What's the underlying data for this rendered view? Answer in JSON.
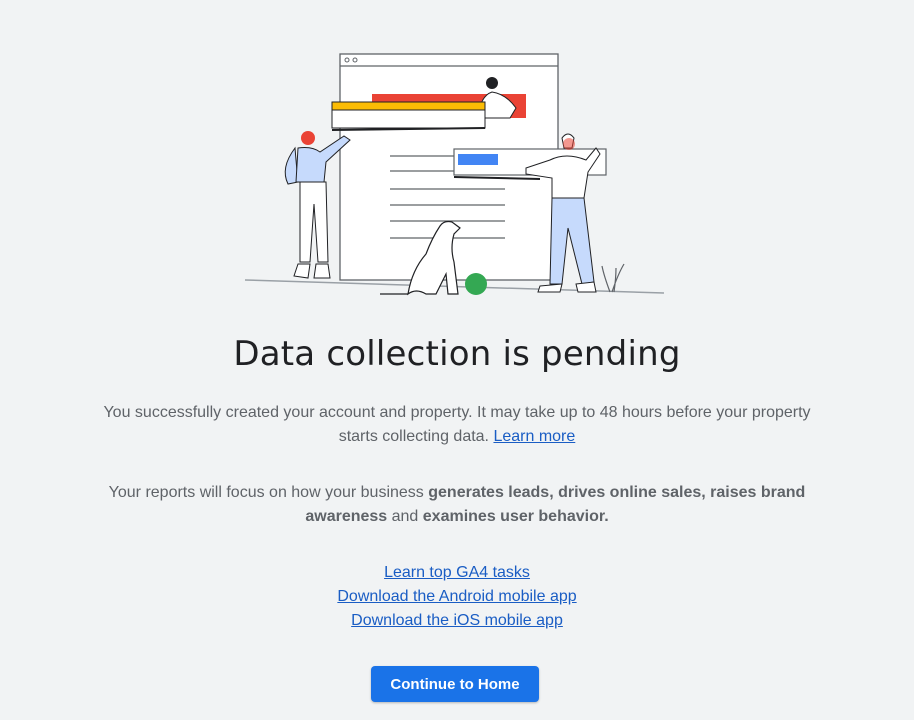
{
  "main": {
    "title": "Data collection is pending",
    "para1_text": "You successfully created your account and property. It may take up to 48 hours before your property starts collecting data. ",
    "para1_link": "Learn more",
    "para2_pre": "Your reports will focus on how your business ",
    "para2_bold1": "generates leads, drives online sales, raises brand awareness",
    "para2_mid": " and ",
    "para2_bold2": "examines user behavior.",
    "links": [
      "Learn top GA4 tasks",
      "Download the Android mobile app",
      "Download the iOS mobile app"
    ],
    "button_label": "Continue to Home"
  },
  "colors": {
    "background": "#f1f3f4",
    "primary_button": "#1a73e8",
    "link": "#1a5dc4",
    "title": "#202124",
    "body_text": "#5f6368",
    "illustration_red": "#ea4335",
    "illustration_yellow": "#fbbc04",
    "illustration_blue": "#4285f4",
    "illustration_green": "#34a853"
  }
}
